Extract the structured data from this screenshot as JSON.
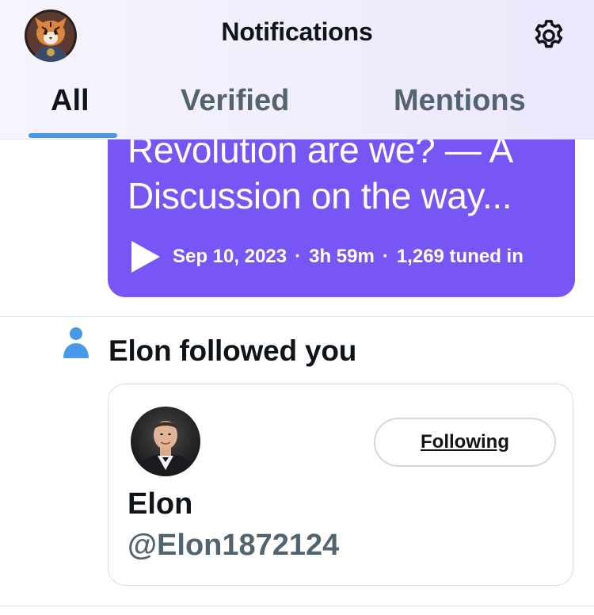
{
  "header": {
    "title": "Notifications",
    "avatar_icon": "tiger-avatar",
    "settings_icon": "gear-icon"
  },
  "tabs": [
    {
      "label": "All",
      "active": true
    },
    {
      "label": "Verified",
      "active": false
    },
    {
      "label": "Mentions",
      "active": false
    }
  ],
  "space_card": {
    "title_line1": "Revolution are we? — A",
    "title_line2": "Discussion on the way...",
    "date": "Sep 10, 2023",
    "separator": "·",
    "duration": "3h 59m",
    "tuned_in": "1,269 tuned in",
    "color": "#7856f5"
  },
  "follow_notification": {
    "text": "Elon followed you",
    "user": {
      "name": "Elon",
      "handle": "@Elon1872124",
      "button_label": "Following"
    }
  },
  "colors": {
    "accent": "#4a99e9",
    "secondary_text": "#536471"
  }
}
